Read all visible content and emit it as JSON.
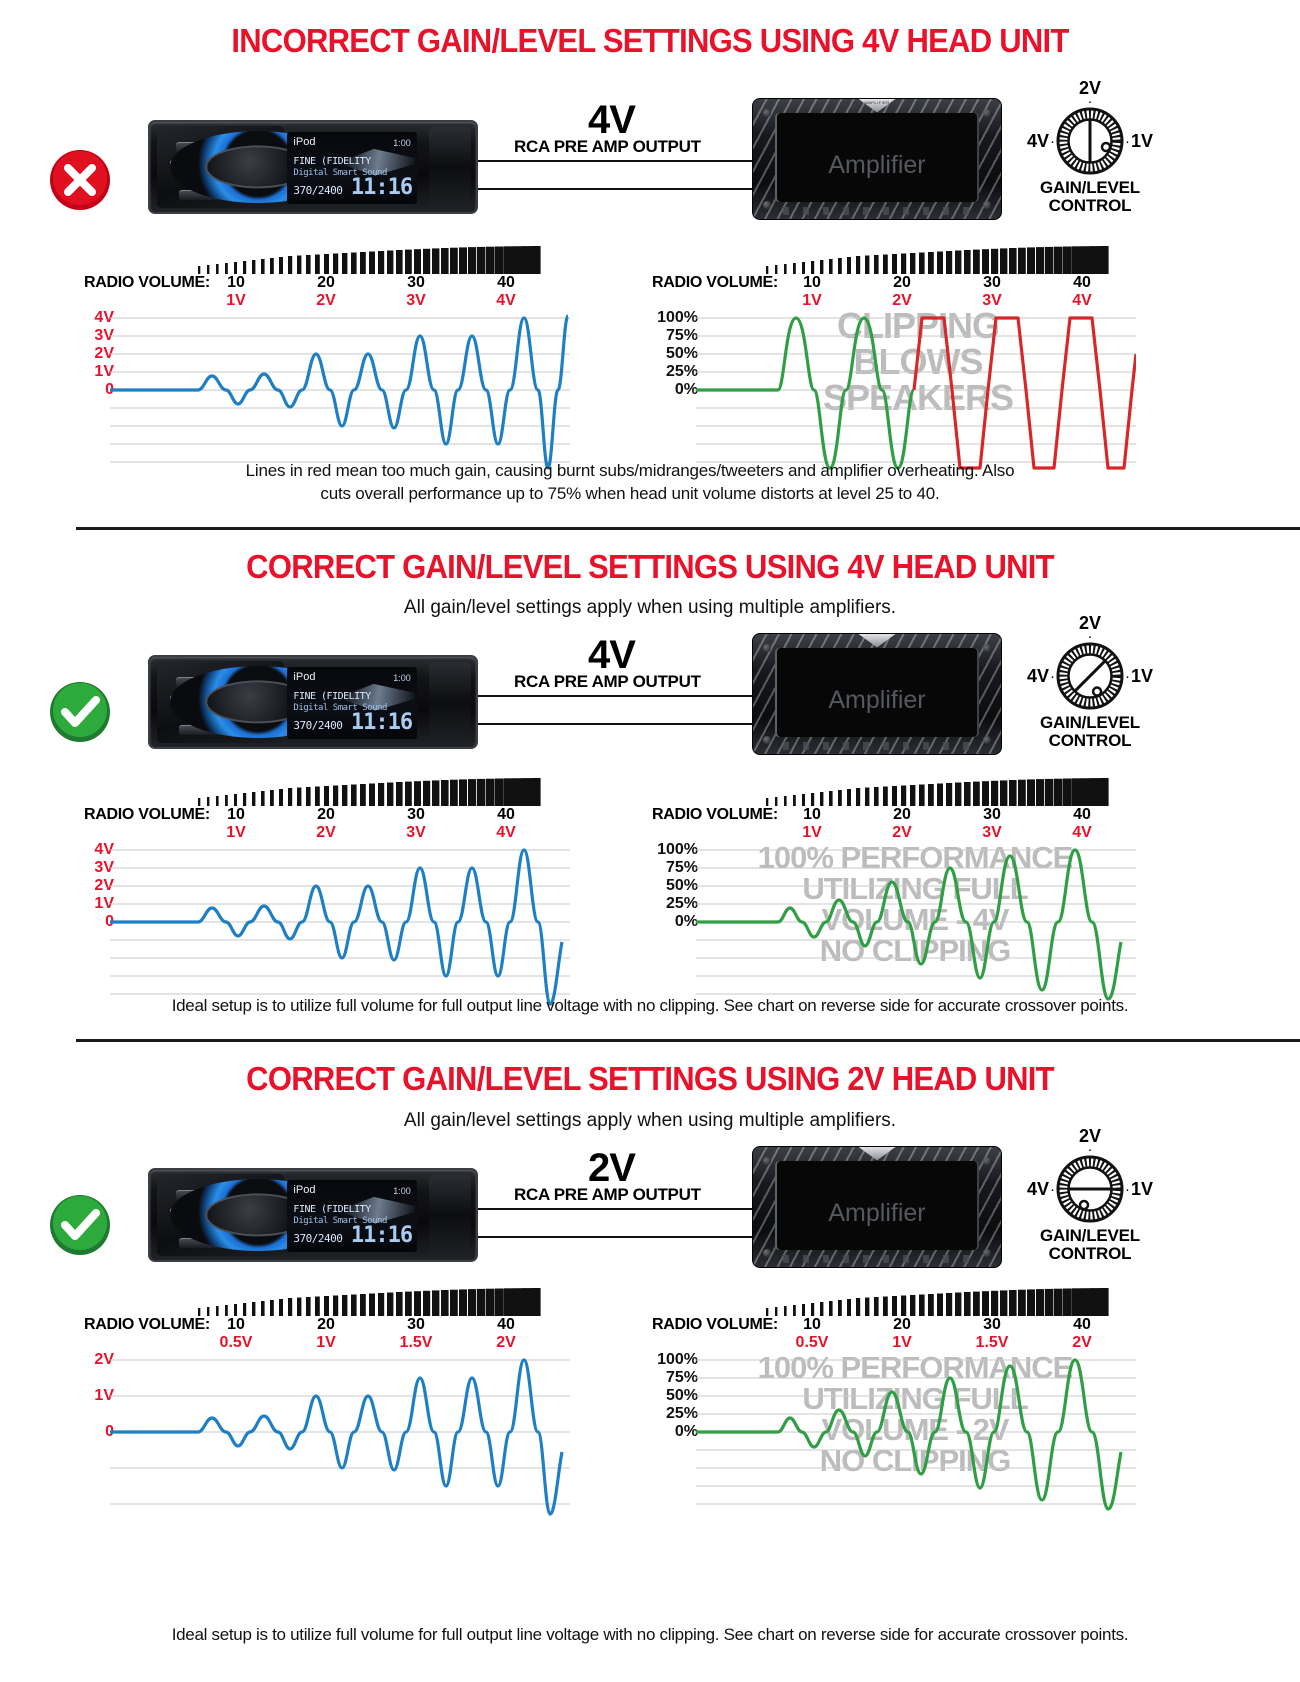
{
  "sections": [
    {
      "id": "incorrect-4v",
      "title": "INCORRECT GAIN/LEVEL SETTINGS USING 4V HEAD UNIT",
      "subtitle": "",
      "badge": "x-mark",
      "rca_voltage": "4V",
      "rca_label": "RCA PRE AMP OUTPUT",
      "amplifier_label": "Amplifier",
      "knob": {
        "top_label": "2V",
        "right_label": "1V",
        "left_label": "4V",
        "control_label_line1": "GAIN/LEVEL",
        "control_label_line2": "CONTROL",
        "angle_deg": 0
      },
      "caption_lines": [
        "Lines in red mean too much gain, causing burnt subs/midranges/tweeters and amplifier overheating. Also",
        "cuts overall performance up to 75% when head unit volume distorts at level 25 to 40."
      ]
    },
    {
      "id": "correct-4v",
      "title": "CORRECT GAIN/LEVEL SETTINGS USING 4V HEAD UNIT",
      "subtitle": "All gain/level settings apply when using multiple amplifiers.",
      "badge": "check-mark",
      "rca_voltage": "4V",
      "rca_label": "RCA PRE AMP OUTPUT",
      "amplifier_label": "Amplifier",
      "knob": {
        "top_label": "2V",
        "right_label": "1V",
        "left_label": "4V",
        "control_label_line1": "GAIN/LEVEL",
        "control_label_line2": "CONTROL",
        "angle_deg": 45
      },
      "caption_lines": [
        "Ideal setup is to utilize full volume for full output line voltage with no clipping. See chart on reverse side for accurate crossover points."
      ]
    },
    {
      "id": "correct-2v",
      "title": "CORRECT GAIN/LEVEL SETTINGS USING 2V HEAD UNIT",
      "subtitle": "All gain/level settings apply when using multiple amplifiers.",
      "badge": "check-mark",
      "rca_voltage": "2V",
      "rca_label": "RCA PRE AMP OUTPUT",
      "amplifier_label": "Amplifier",
      "knob": {
        "top_label": "2V",
        "right_label": "1V",
        "left_label": "4V",
        "control_label_line1": "GAIN/LEVEL",
        "control_label_line2": "CONTROL",
        "angle_deg": 90
      },
      "caption_lines": [
        "Ideal setup is to utilize full volume for full output line voltage with no clipping. See chart on reverse side for accurate crossover points."
      ]
    }
  ],
  "head_unit_display": {
    "source": "iPod",
    "track_time": "1:00",
    "line_fine": "FINE (FIDELITY",
    "line_digital": "Digital Smart Sound",
    "line_freq": "370/2400",
    "clock": "11:16"
  },
  "chart_data": [
    {
      "id": "incorrect-4v-left",
      "type": "line",
      "title": "",
      "xlabel": "RADIO VOLUME:",
      "ylabel": "",
      "volume_ticks": [
        "10",
        "20",
        "30",
        "40"
      ],
      "volume_voltages": [
        "1V",
        "2V",
        "3V",
        "4V"
      ],
      "yticks": [
        "4V",
        "3V",
        "2V",
        "1V",
        "0"
      ],
      "ylim": [
        -4,
        4
      ],
      "grid": true,
      "series": [
        {
          "name": "output-voltage",
          "color": "#1f7fc4",
          "clipped": false,
          "amplitudes": [
            0,
            0.85,
            0.85,
            1.9,
            1.9,
            2.9,
            2.9,
            3.85,
            3.85,
            4.0
          ]
        }
      ],
      "annotation": ""
    },
    {
      "id": "incorrect-4v-right",
      "type": "line",
      "title": "",
      "xlabel": "RADIO VOLUME:",
      "ylabel": "",
      "volume_ticks": [
        "10",
        "20",
        "30",
        "40"
      ],
      "volume_voltages": [
        "1V",
        "2V",
        "3V",
        "4V"
      ],
      "yticks": [
        "100%",
        "75%",
        "50%",
        "25%",
        "0%"
      ],
      "ylim": [
        -100,
        100
      ],
      "grid": true,
      "series": [
        {
          "name": "clean-output",
          "color": "#2f9e44",
          "clipped": false,
          "cycles": 2
        },
        {
          "name": "clipped-output",
          "color": "#d62828",
          "clipped": true,
          "cycles": 8
        }
      ],
      "annotation": "CLIPPING BLOWS SPEAKERS"
    },
    {
      "id": "correct-4v-left",
      "type": "line",
      "xlabel": "RADIO VOLUME:",
      "volume_ticks": [
        "10",
        "20",
        "30",
        "40"
      ],
      "volume_voltages": [
        "1V",
        "2V",
        "3V",
        "4V"
      ],
      "yticks": [
        "4V",
        "3V",
        "2V",
        "1V",
        "0"
      ],
      "ylim": [
        -4,
        4
      ],
      "grid": true,
      "series": [
        {
          "name": "output-voltage",
          "color": "#1f7fc4",
          "clipped": false,
          "amplitudes": [
            0,
            0.85,
            0.85,
            1.9,
            1.9,
            2.9,
            2.9,
            3.85,
            3.85,
            4.0
          ]
        }
      ],
      "annotation": ""
    },
    {
      "id": "correct-4v-right",
      "type": "line",
      "xlabel": "RADIO VOLUME:",
      "volume_ticks": [
        "10",
        "20",
        "30",
        "40"
      ],
      "volume_voltages": [
        "1V",
        "2V",
        "3V",
        "4V"
      ],
      "yticks": [
        "100%",
        "75%",
        "50%",
        "25%",
        "0%"
      ],
      "ylim": [
        -100,
        100
      ],
      "grid": true,
      "series": [
        {
          "name": "clean-output",
          "color": "#2f9e44",
          "clipped": false,
          "cycles": 10
        }
      ],
      "annotation": "100% PERFORMANCE UTILIZING FULL VOLUME - 4V NO CLIPPING"
    },
    {
      "id": "correct-2v-left",
      "type": "line",
      "xlabel": "RADIO VOLUME:",
      "volume_ticks": [
        "10",
        "20",
        "30",
        "40"
      ],
      "volume_voltages": [
        "0.5V",
        "1V",
        "1.5V",
        "2V"
      ],
      "yticks": [
        "2V",
        "1V",
        "0"
      ],
      "ylim": [
        -2,
        2
      ],
      "grid": true,
      "series": [
        {
          "name": "output-voltage",
          "color": "#1f7fc4",
          "clipped": false,
          "amplitudes": [
            0,
            0.45,
            0.45,
            0.95,
            0.95,
            1.45,
            1.45,
            1.92,
            1.92,
            2.0
          ]
        }
      ],
      "annotation": ""
    },
    {
      "id": "correct-2v-right",
      "type": "line",
      "xlabel": "RADIO VOLUME:",
      "volume_ticks": [
        "10",
        "20",
        "30",
        "40"
      ],
      "volume_voltages": [
        "0.5V",
        "1V",
        "1.5V",
        "2V"
      ],
      "yticks": [
        "100%",
        "75%",
        "50%",
        "25%",
        "0%"
      ],
      "ylim": [
        -100,
        100
      ],
      "grid": true,
      "series": [
        {
          "name": "clean-output",
          "color": "#2f9e44",
          "clipped": false,
          "cycles": 10
        }
      ],
      "annotation": "100% PERFORMANCE UTILIZING FULL VOLUME - 2V NO CLIPPING"
    }
  ],
  "watermarks": {
    "clipping": [
      "CLIPPING",
      "BLOWS",
      "SPEAKERS"
    ],
    "performance_4v": [
      "100% PERFORMANCE",
      "UTILIZING FULL",
      "VOLUME - 4V",
      "NO CLIPPING"
    ],
    "performance_2v": [
      "100% PERFORMANCE",
      "UTILIZING FULL",
      "VOLUME - 2V",
      "NO CLIPPING"
    ]
  },
  "colors": {
    "red": "#e8122a",
    "blue": "#1f7fc4",
    "green": "#2f9e44",
    "clip_red": "#d62828",
    "watermark": "#bcbcbc",
    "black": "#111111"
  }
}
